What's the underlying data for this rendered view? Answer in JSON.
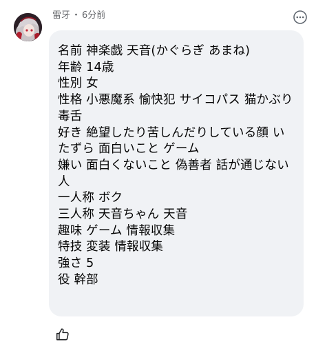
{
  "comment": {
    "author": "雷牙",
    "separator": "・",
    "time": "6分前",
    "lines": [
      "名前  神楽戯 天音(かぐらぎ あまね)",
      "年齢  14歳",
      "性別  女",
      "性格  小悪魔系 愉快犯 サイコパス 猫かぶり",
      "毒舌",
      "好き  絶望したり苦しんだりしている顔 い",
      "たずら 面白いこと ゲーム",
      "嫌い  面白くないこと 偽善者 話が通じない",
      "人",
      "一人称  ボク",
      "三人称  天音ちゃん 天音",
      "趣味  ゲーム 情報収集",
      "特技  変装 情報収集",
      "強さ 5",
      "役 幹部"
    ]
  },
  "icons": {
    "avatar": "profile-avatar",
    "more": "more-options-icon",
    "like": "thumbs-up-icon"
  },
  "colors": {
    "bubble_background": "#f0f2f5",
    "meta_text": "#65676b",
    "body_text": "#050505"
  }
}
